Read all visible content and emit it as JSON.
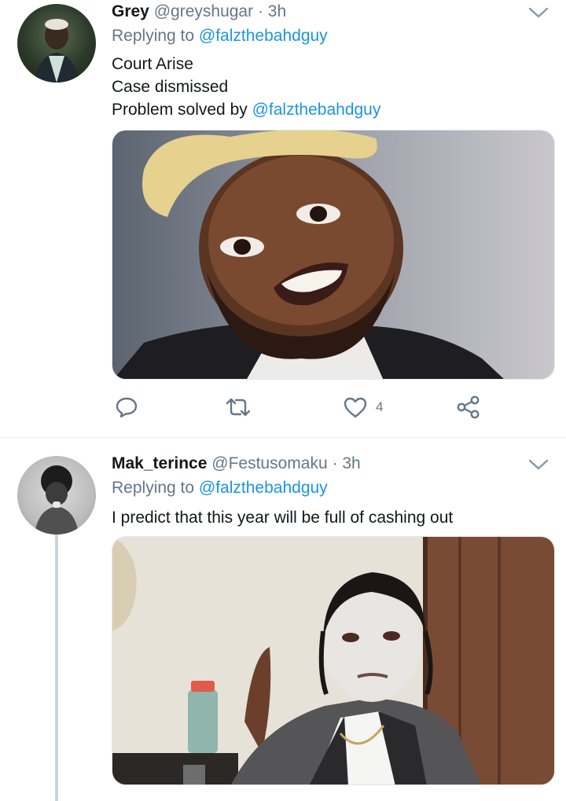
{
  "tweets": [
    {
      "display_name": "Grey",
      "handle": "@greyshugar",
      "separator": "·",
      "time": "3h",
      "replying_prefix": "Replying to",
      "replying_to": "@falzthebahdguy",
      "lines": [
        "Court Arise",
        "Case dismissed"
      ],
      "last_line_prefix": "Problem solved by",
      "last_line_mention": "@falzthebahdguy",
      "actions": {
        "like_count": "4"
      },
      "avatar_icon": "user-avatar",
      "media_icon": "photo"
    },
    {
      "display_name": "Mak_terince",
      "handle": "@Festusomaku",
      "separator": "·",
      "time": "3h",
      "replying_prefix": "Replying to",
      "replying_to": "@falzthebahdguy",
      "text": "I predict that this year will be full of cashing out",
      "avatar_icon": "user-avatar",
      "media_icon": "photo"
    }
  ],
  "colors": {
    "link": "#1b95e0",
    "secondary_text": "#657786",
    "primary_text": "#14171a",
    "divider": "#e6ecf0",
    "thread_line": "#c9d6df"
  }
}
